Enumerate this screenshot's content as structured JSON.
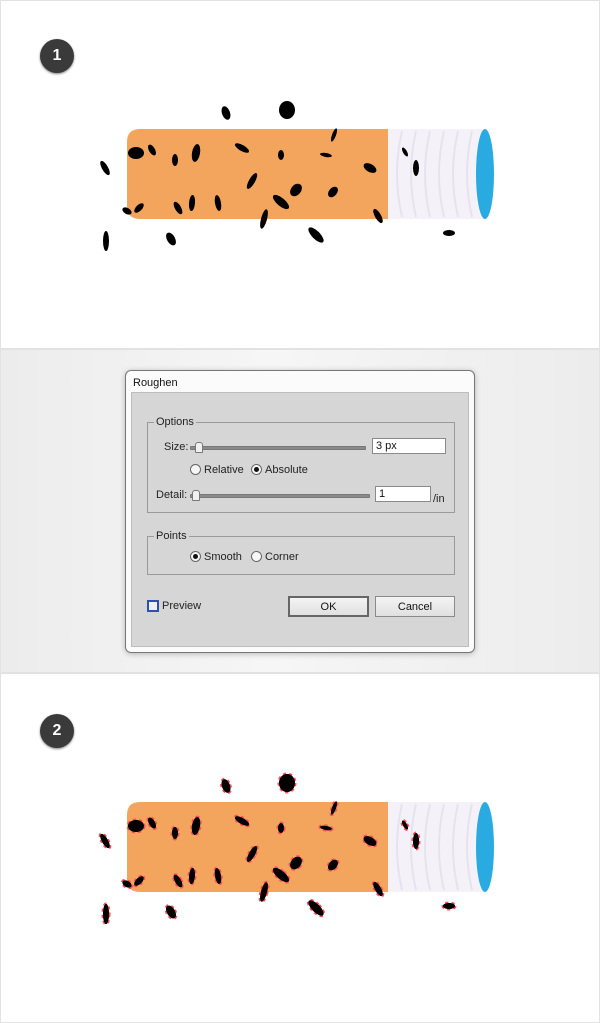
{
  "steps": {
    "one": "1",
    "two": "2"
  },
  "colors": {
    "cigarette_body": "#f3a55d",
    "filter": "#f4f2f8",
    "filter_tip": "#29abe2",
    "specks": "#000000",
    "anchor_points": "#ff4d5b"
  },
  "dialog": {
    "title": "Roughen",
    "options": {
      "legend": "Options",
      "size_label": "Size:",
      "size_value": "3 px",
      "size_slider_fraction": 0.03,
      "relative_label": "Relative",
      "absolute_label": "Absolute",
      "selected_mode": "Absolute",
      "detail_label": "Detail:",
      "detail_value": "1",
      "detail_unit": "/in",
      "detail_slider_fraction": 0.01
    },
    "points": {
      "legend": "Points",
      "smooth_label": "Smooth",
      "corner_label": "Corner",
      "selected": "Smooth"
    },
    "preview_label": "Preview",
    "preview_checked": false,
    "ok_label": "OK",
    "cancel_label": "Cancel"
  }
}
